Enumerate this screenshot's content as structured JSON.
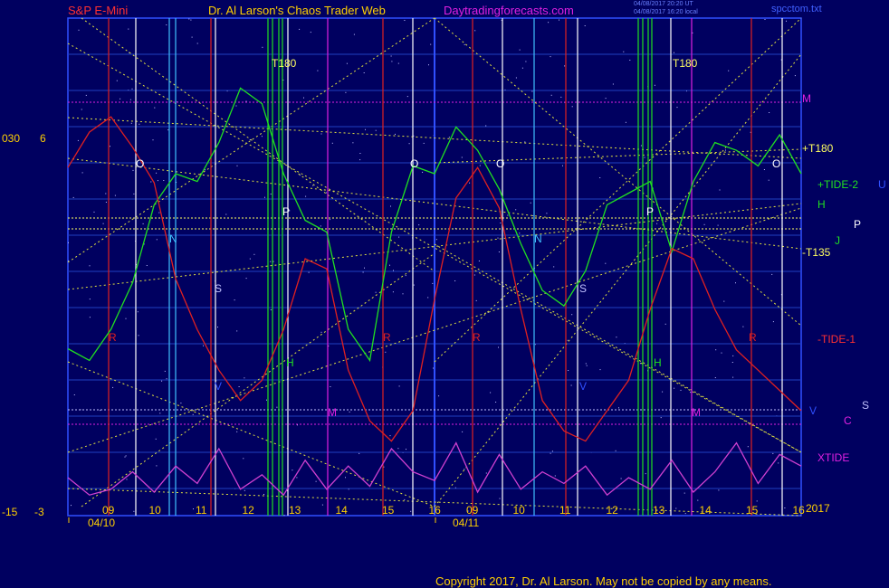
{
  "header": {
    "instrument": "S&P E-Mini",
    "site": "Dr. Al Larson's Chaos Trader Web",
    "url": "Daytradingforecasts.com",
    "stamp1": "04/08/2017 20:20 UT",
    "stamp2": "04/08/2017 16:20 local",
    "file": "spcctom.txt"
  },
  "left_scale": {
    "top_a": "030",
    "top_b": "6",
    "bottom_a": "-15",
    "bottom_b": "-3"
  },
  "right_labels": {
    "m": "M",
    "tplus180": "+T180",
    "tide2": "+TIDE-2",
    "u": "U",
    "h": "H",
    "p": "P",
    "j": "J",
    "tminus135": "-T135",
    "tide1": "-TIDE-1",
    "v": "V",
    "s": "S",
    "c": "C",
    "xtide": "XTIDE",
    "year": "2017"
  },
  "chart_data": {
    "type": "line",
    "title": "S&P E-Mini",
    "x_hours": [
      "09",
      "10",
      "11",
      "12",
      "13",
      "14",
      "15",
      "16",
      "09",
      "10",
      "11",
      "12",
      "13",
      "14",
      "15",
      "16"
    ],
    "dates": [
      "04/10",
      "04/11"
    ],
    "day_markers": [
      "T180",
      "O",
      "N",
      "S",
      "P",
      "H",
      "R",
      "V",
      "M"
    ],
    "series": [
      {
        "name": "+TIDE-2",
        "color": "#20e020",
        "values": [
          15,
          12,
          20,
          32,
          52,
          60,
          58,
          68,
          82,
          78,
          60,
          48,
          45,
          20,
          12,
          45,
          62,
          60,
          72,
          66,
          56,
          42,
          30,
          26,
          35,
          52,
          55,
          58,
          40,
          58,
          68,
          66,
          62,
          70,
          60
        ]
      },
      {
        "name": "-TIDE-1",
        "color": "#e02020",
        "values": [
          58,
          65,
          68,
          62,
          55,
          36,
          26,
          18,
          12,
          16,
          26,
          40,
          38,
          18,
          8,
          4,
          10,
          32,
          52,
          58,
          50,
          30,
          12,
          6,
          4,
          10,
          16,
          30,
          42,
          40,
          30,
          22,
          18,
          14,
          10
        ]
      },
      {
        "name": "XTIDE",
        "color": "#d040d0",
        "values": [
          10,
          4,
          6,
          12,
          5,
          14,
          8,
          20,
          6,
          11,
          4,
          16,
          6,
          14,
          7,
          20,
          12,
          9,
          22,
          5,
          18,
          6,
          12,
          8,
          14,
          4,
          10,
          6,
          16,
          5,
          12,
          22,
          8,
          18,
          14
        ]
      }
    ],
    "grid": true
  },
  "footer": {
    "copyright": "Copyright 2017, Dr. Al Larson. May not be copied by any means."
  }
}
